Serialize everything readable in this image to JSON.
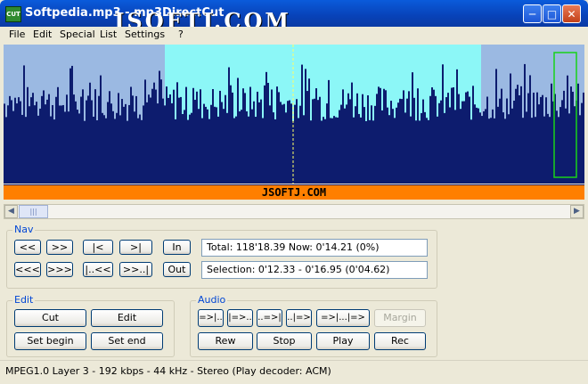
{
  "window": {
    "title": "Softpedia.mp3 - mp3DirectCut",
    "watermark": "JSOFTJ.COM",
    "app_icon_text": "CUT"
  },
  "menu": [
    "File",
    "Edit",
    "Special",
    "List",
    "Settings",
    "?"
  ],
  "waveform": {
    "colors": {
      "background": "#9bb9e2",
      "selection": "#8cf7f7",
      "wave": "#0d1c6e",
      "cursor": "#ffff66",
      "frame": "#19d219"
    }
  },
  "banner": {
    "text": "JSOFTJ.COM",
    "color": "#ff7f00"
  },
  "nav": {
    "label": "Nav",
    "row1": [
      "<<",
      ">>",
      "|<",
      ">|",
      "In"
    ],
    "row2": [
      "<<<",
      ">>>",
      "|..<<",
      ">>..|",
      "Out"
    ],
    "total_text": "Total: 118'18.39  Now: 0'14.21  (0%)",
    "selection_text": "Selection: 0'12.33 - 0'16.95 (0'04.62)"
  },
  "edit": {
    "label": "Edit",
    "buttons": [
      "Cut",
      "Edit",
      "Set begin",
      "Set end"
    ]
  },
  "audio": {
    "label": "Audio",
    "row1": [
      "=>|..",
      "|=>..",
      "..=>|",
      "..|=>",
      "=>|...|=>",
      "Margin"
    ],
    "row2": [
      "Rew",
      "Stop",
      "Play",
      "Rec"
    ]
  },
  "status": "MPEG1.0 Layer 3 - 192 kbps - 44 kHz - Stereo   (Play decoder: ACM)"
}
